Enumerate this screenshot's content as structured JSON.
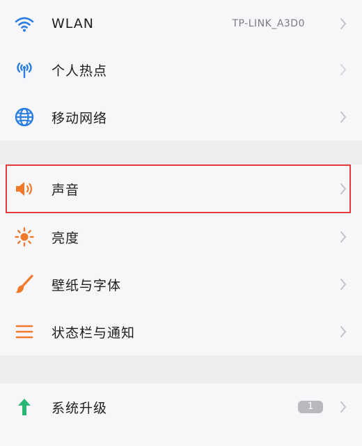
{
  "colors": {
    "blue_icon": "#2a7de1",
    "orange_icon": "#f07a2a",
    "green_icon": "#2bb673",
    "highlight_border": "#e53a3a",
    "chevron": "#c3c3c7"
  },
  "items": [
    {
      "label": "WLAN",
      "value": "TP-LINK_A3D0",
      "icon": "wifi-icon"
    },
    {
      "label": "个人热点",
      "icon": "hotspot-icon"
    },
    {
      "label": "移动网络",
      "icon": "globe-icon"
    },
    {
      "label": "声音",
      "icon": "speaker-icon"
    },
    {
      "label": "亮度",
      "icon": "sun-icon"
    },
    {
      "label": "壁纸与字体",
      "icon": "brush-icon"
    },
    {
      "label": "状态栏与通知",
      "icon": "list-icon"
    },
    {
      "label": "系统升级",
      "badge": "1",
      "icon": "arrow-up-icon"
    }
  ]
}
